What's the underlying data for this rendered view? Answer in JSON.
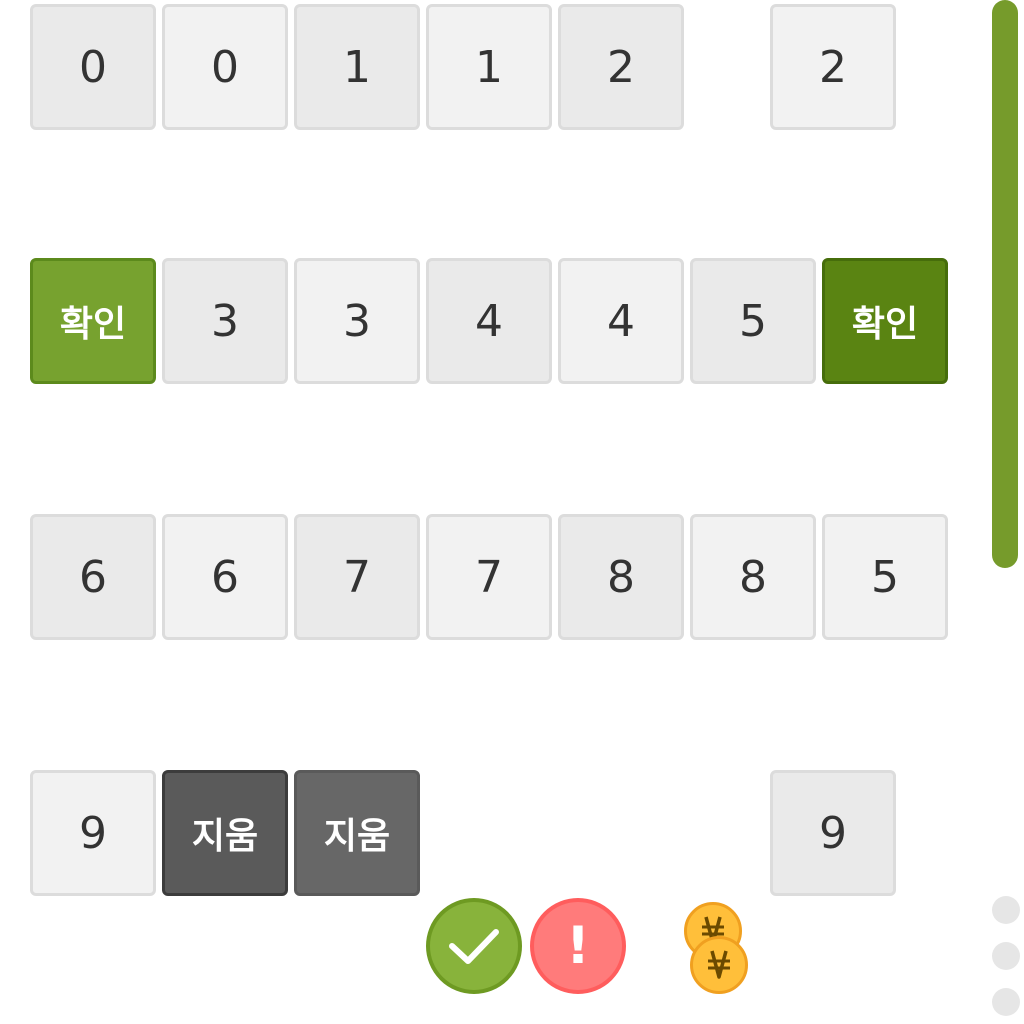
{
  "keypad": {
    "row1": [
      "0",
      "0",
      "1",
      "1",
      "2",
      "2"
    ],
    "row2": [
      "확인",
      "3",
      "3",
      "4",
      "4",
      "5",
      "확인"
    ],
    "row3": [
      "6",
      "6",
      "7",
      "7",
      "8",
      "8",
      "5"
    ],
    "row4": [
      "9",
      "지움",
      "지움",
      "9"
    ]
  },
  "controls": {
    "check_icon": "check-icon",
    "warning_label": "!",
    "coins_icon": "won-coins-icon"
  },
  "colors": {
    "accent_green": "#77a22f",
    "dark_green": "#5a8412",
    "erase_gray": "#5a5a5a",
    "warning_red": "#ff7b7b",
    "coin_gold": "#ffbf3a"
  }
}
